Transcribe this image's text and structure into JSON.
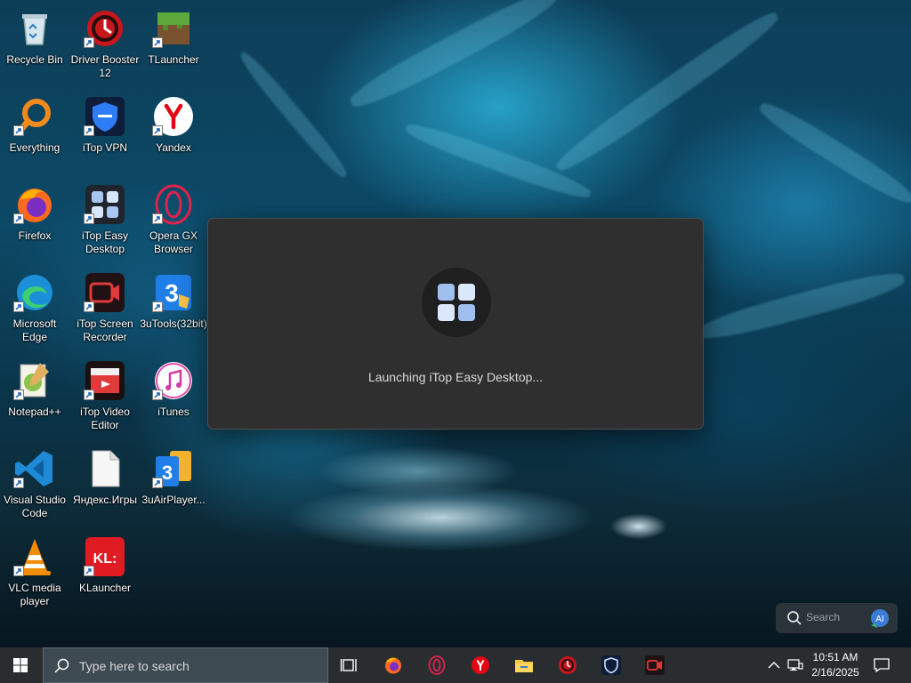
{
  "desktop": {
    "icons": [
      {
        "label": "Recycle Bin"
      },
      {
        "label": "Driver Booster 12"
      },
      {
        "label": "TLauncher"
      },
      {
        "label": "Everything"
      },
      {
        "label": "iTop VPN"
      },
      {
        "label": "Yandex"
      },
      {
        "label": "Firefox"
      },
      {
        "label": "iTop Easy Desktop"
      },
      {
        "label": "Opera GX Browser"
      },
      {
        "label": "Microsoft Edge"
      },
      {
        "label": "iTop Screen Recorder"
      },
      {
        "label": "3uTools(32bit)"
      },
      {
        "label": "Notepad++"
      },
      {
        "label": "iTop Video Editor"
      },
      {
        "label": "iTunes"
      },
      {
        "label": "Visual Studio Code"
      },
      {
        "label": "Яндекс.Игры"
      },
      {
        "label": "3uAirPlayer..."
      },
      {
        "label": "VLC media player"
      },
      {
        "label": "KLauncher"
      }
    ]
  },
  "dialog": {
    "message": "Launching iTop Easy Desktop..."
  },
  "search_widget": {
    "placeholder": "Search",
    "ai_badge": "AI"
  },
  "taskbar": {
    "search_placeholder": "Type here to search",
    "pinned": [
      {
        "icon": "task-view-icon"
      },
      {
        "icon": "firefox-icon"
      },
      {
        "icon": "opera-gx-icon"
      },
      {
        "icon": "yandex-icon"
      },
      {
        "icon": "file-explorer-icon"
      },
      {
        "icon": "driver-booster-icon"
      },
      {
        "icon": "itop-vpn-icon"
      },
      {
        "icon": "itop-screen-recorder-icon"
      }
    ],
    "clock": {
      "time": "10:51 AM",
      "date": "2/16/2025"
    }
  },
  "colors": {
    "taskbar_bg": "#2a2d30",
    "dialog_bg": "#2f2f2f",
    "accent": "#0078d4"
  }
}
